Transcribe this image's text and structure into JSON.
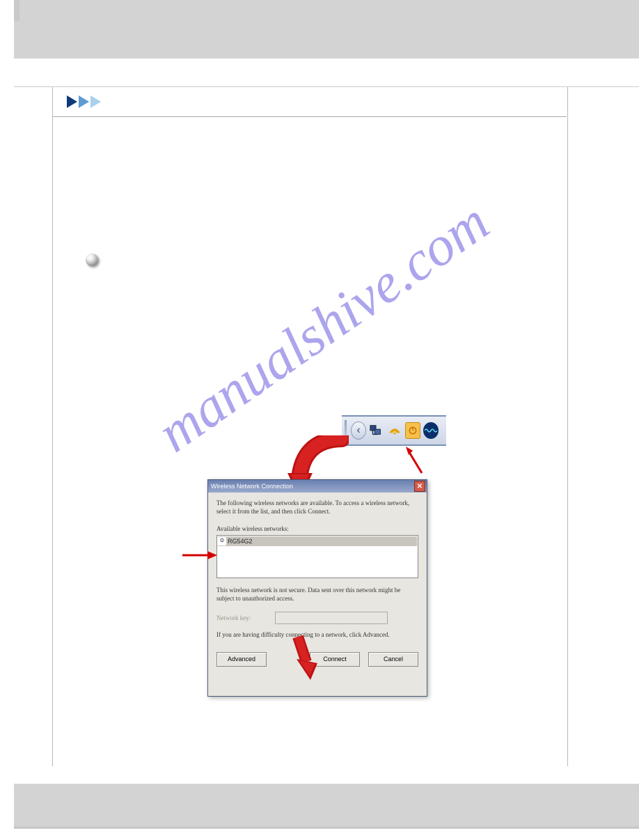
{
  "watermark": "manualshive.com",
  "dialog": {
    "title": "Wireless Network Connection",
    "intro": "The following wireless networks are available. To access a wireless network, select it from the list, and then click Connect.",
    "available_label": "Available wireless networks:",
    "network_item": "RG54G2",
    "warning": "This wireless network is not secure. Data sent over this network might be subject to unauthorized access.",
    "key_label": "Network key:",
    "help": "If you are having difficulty connecting to a network, click Advanced.",
    "buttons": {
      "advanced": "Advanced",
      "connect": "Connect",
      "cancel": "Cancel"
    },
    "close": "✕"
  },
  "tray": {
    "back": "‹"
  }
}
